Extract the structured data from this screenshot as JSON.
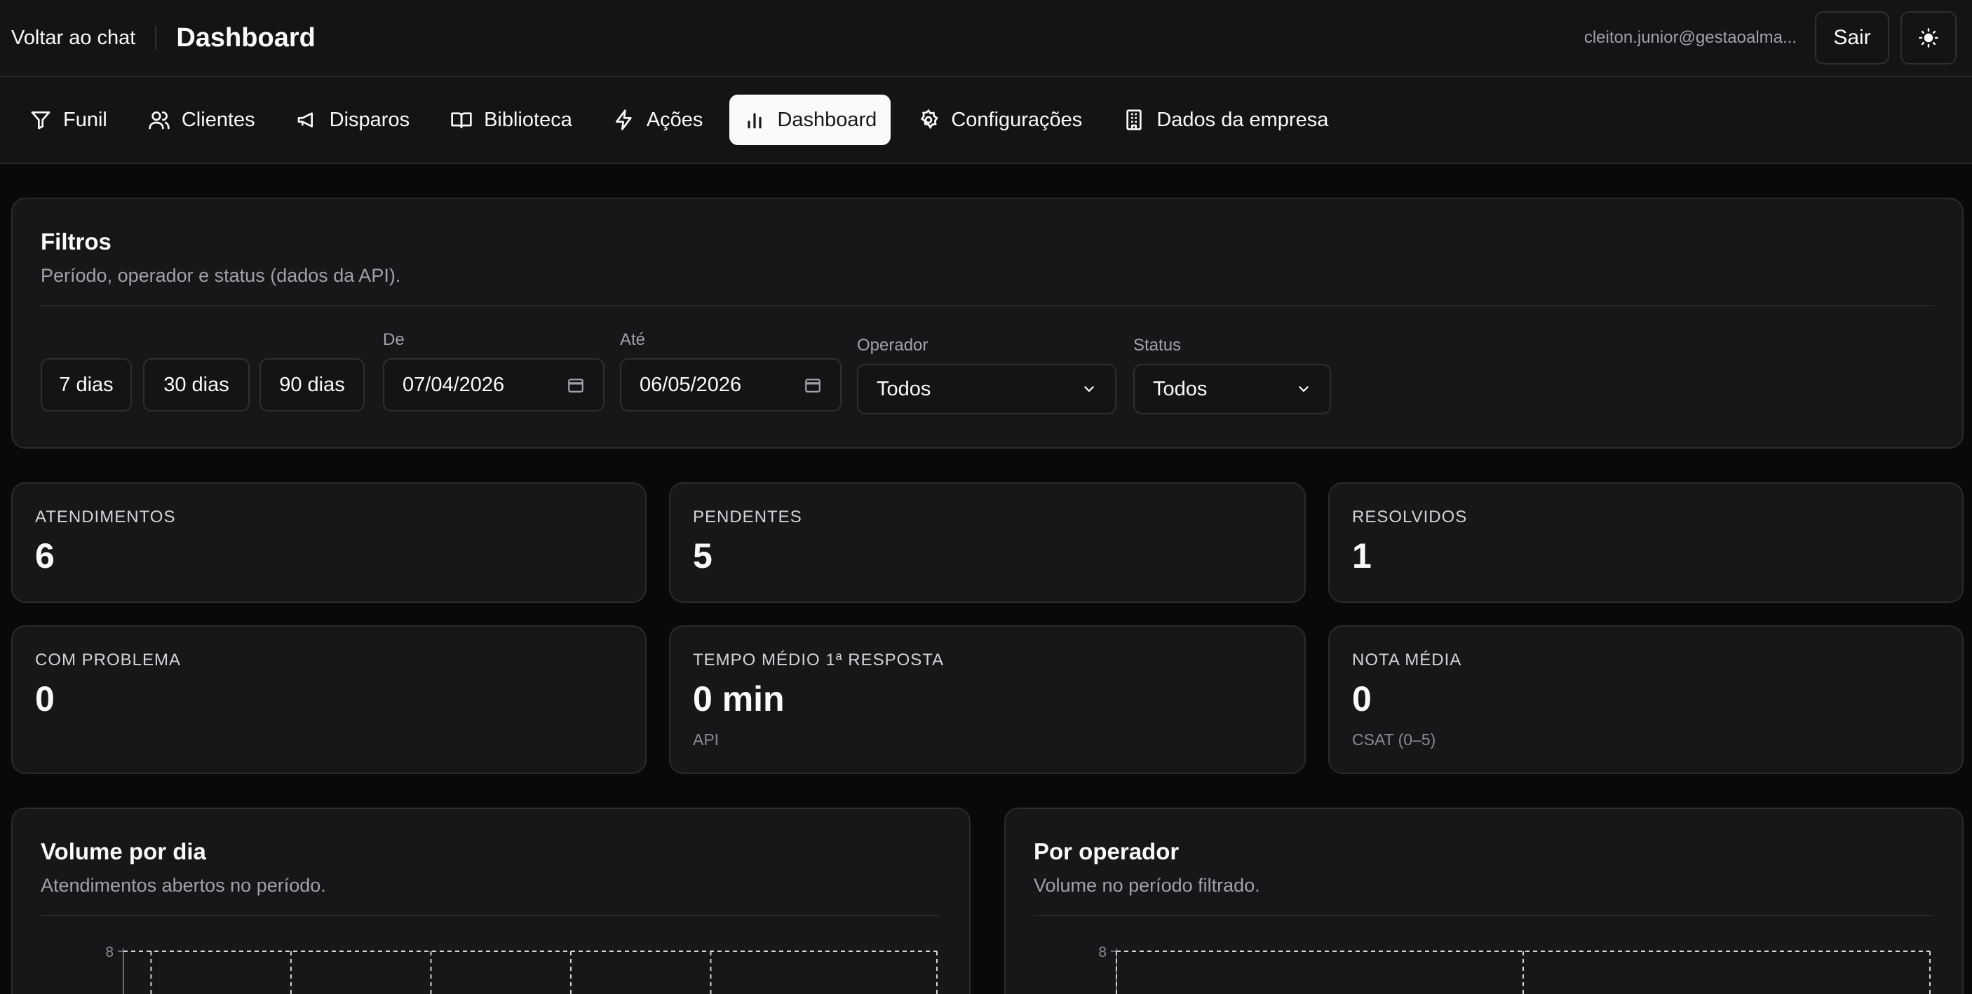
{
  "header": {
    "back_label": "Voltar ao chat",
    "title": "Dashboard",
    "user_email": "cleiton.junior@gestaoalma...",
    "logout_label": "Sair"
  },
  "nav": {
    "items": [
      {
        "label": "Funil",
        "icon": "funnel-icon"
      },
      {
        "label": "Clientes",
        "icon": "users-icon"
      },
      {
        "label": "Disparos",
        "icon": "megaphone-icon"
      },
      {
        "label": "Biblioteca",
        "icon": "book-icon"
      },
      {
        "label": "Ações",
        "icon": "bolt-icon"
      },
      {
        "label": "Dashboard",
        "icon": "bar-chart-icon",
        "active": true
      },
      {
        "label": "Configurações",
        "icon": "gear-icon"
      },
      {
        "label": "Dados da empresa",
        "icon": "building-icon"
      }
    ]
  },
  "filters": {
    "title": "Filtros",
    "subtitle": "Período, operador e status (dados da API).",
    "presets": [
      "7 dias",
      "30 dias",
      "90 dias"
    ],
    "from_label": "De",
    "from_value": "07/04/2026",
    "to_label": "Até",
    "to_value": "06/05/2026",
    "operator_label": "Operador",
    "operator_value": "Todos",
    "status_label": "Status",
    "status_value": "Todos"
  },
  "stats": [
    {
      "label": "ATENDIMENTOS",
      "value": "6"
    },
    {
      "label": "PENDENTES",
      "value": "5"
    },
    {
      "label": "RESOLVIDOS",
      "value": "1"
    },
    {
      "label": "COM PROBLEMA",
      "value": "0"
    },
    {
      "label": "TEMPO MÉDIO 1ª RESPOSTA",
      "value": "0 min",
      "note": "API"
    },
    {
      "label": "NOTA MÉDIA",
      "value": "0",
      "note": "CSAT (0–5)"
    }
  ],
  "charts": {
    "volume": {
      "title": "Volume por dia",
      "subtitle": "Atendimentos abertos no período."
    },
    "operator": {
      "title": "Por operador",
      "subtitle": "Volume no período filtrado."
    }
  },
  "chart_data": [
    {
      "type": "bar",
      "yticks": [
        "8"
      ],
      "ylim": [
        0,
        8
      ]
    },
    {
      "type": "bar",
      "yticks": [
        "8"
      ],
      "ylim": [
        0,
        8
      ]
    }
  ]
}
